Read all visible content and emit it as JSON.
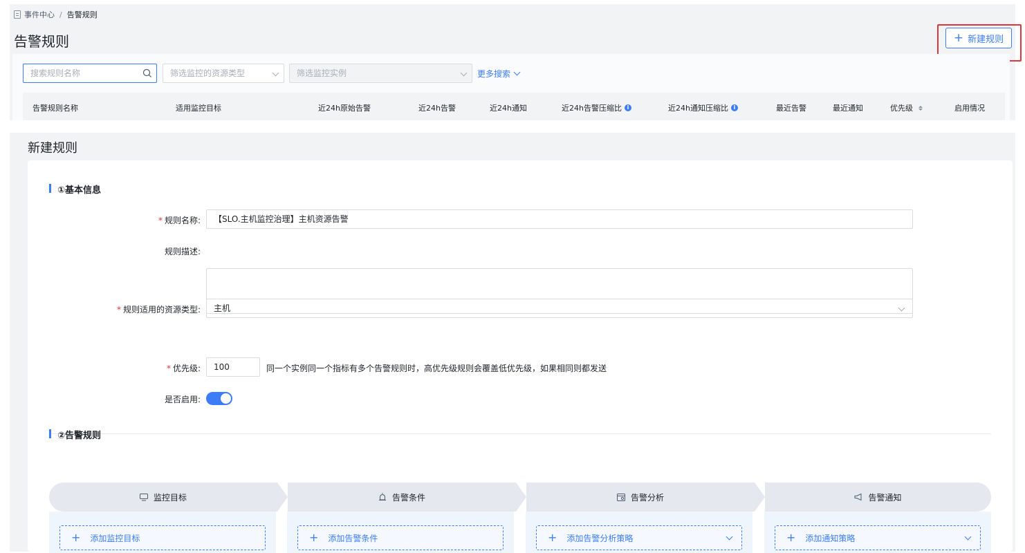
{
  "breadcrumb": {
    "parent": "事件中心",
    "separator": "/",
    "current": "告警规则"
  },
  "list": {
    "title": "告警规则",
    "new_rule_button": "新建规则",
    "search_placeholder": "搜索规则名称",
    "resource_type_placeholder": "筛选监控的资源类型",
    "instance_placeholder": "筛选监控实例",
    "more_search": "更多搜索",
    "columns": [
      "告警规则名称",
      "适用监控目标",
      "近24h原始告警",
      "近24h告警",
      "近24h通知",
      "近24h告警压缩比",
      "近24h通知压缩比",
      "最近告警",
      "最近通知",
      "优先级",
      "启用情况"
    ]
  },
  "form": {
    "title": "新建规则",
    "section1": "①基本信息",
    "name_label": "规则名称:",
    "name_value": "【SLO.主机监控治理】主机资源告警",
    "desc_label": "规则描述:",
    "resource_label": "规则适用的资源类型:",
    "resource_value": "主机",
    "priority_label": "优先级:",
    "priority_value": "100",
    "priority_hint": "同一个实例同一个指标有多个告警规则时，高优先级规则会覆盖低优先级，如果相同则都发送",
    "enable_label": "是否启用:",
    "enabled": true,
    "required_mark": "*",
    "section2": "②告警规则",
    "steps": [
      {
        "label": "监控目标",
        "icon": "monitor-icon",
        "add_label": "添加监控目标",
        "has_dropdown": false
      },
      {
        "label": "告警条件",
        "icon": "alarm-icon",
        "add_label": "添加告警条件",
        "has_dropdown": false
      },
      {
        "label": "告警分析",
        "icon": "calendar-icon",
        "add_label": "添加告警分析策略",
        "has_dropdown": true
      },
      {
        "label": "告警通知",
        "icon": "megaphone-icon",
        "add_label": "添加通知策略",
        "has_dropdown": true
      }
    ]
  },
  "colors": {
    "accent": "#3c7cf6",
    "highlight": "#d9363e",
    "panel_bg": "#f2f3f5"
  }
}
